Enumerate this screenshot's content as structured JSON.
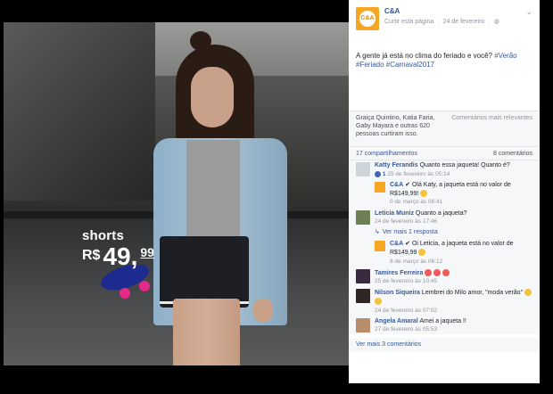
{
  "photo": {
    "price_label": "shorts",
    "price_currency": "R$",
    "price_int": "49,",
    "price_cents": "99"
  },
  "post": {
    "page_name": "C&A",
    "logo_text": "C&A",
    "follow_label": "Curtir esta página",
    "date": "24 de fevereiro",
    "globe_icon": "globe-icon",
    "text": "A gente já está no clima do feriado e você?",
    "tags": "#Verão #Feriado #Carnaval2017"
  },
  "likes": {
    "text": "Graiça Quintino, Katia Faria, Gaby Mayara e outras 620 pessoas curtiram isso.",
    "sort_label": "Comentários mais relevantes"
  },
  "counts": {
    "shares": "17 compartilhamentos",
    "comments": "8 comentários"
  },
  "comments": [
    {
      "author": "Katty Ferandis",
      "text": "Quanto essa jaqueta! Quanto é?",
      "likes": "1",
      "meta": "25 de fevereiro às 05:14"
    },
    {
      "author": "C&A",
      "text": "Olá Katy, a jaqueta está no valor de R$149,99!",
      "meta": "0 de março às 06:41"
    },
    {
      "author": "Leticia Muniz",
      "text": "Quanto a jaqueta?",
      "meta": "24 de fevereiro às 17:46"
    },
    {
      "author": "C&A",
      "text": "Oi Leticia, a jaqueta está no valor de R$149,99",
      "meta": "8 de março às 06:12"
    },
    {
      "author": "Tamires Ferreira",
      "text": "",
      "meta": "25 de fevereiro às 10:45"
    },
    {
      "author": "Nilson Siqueira",
      "text": "Lembrei do Milo amor, \"moda verão\"",
      "meta": "24 de fevereiro às 07:02"
    },
    {
      "author": "Angela Amaral",
      "text": "Amei a jaqueta !!",
      "meta": "27 de fevereiro às 05:53"
    }
  ],
  "replies_link": "Ver mais 1 resposta",
  "more_comments": "Ver mais 3 comentários",
  "colors": {
    "brand": "#f5a623",
    "link": "#365899"
  }
}
